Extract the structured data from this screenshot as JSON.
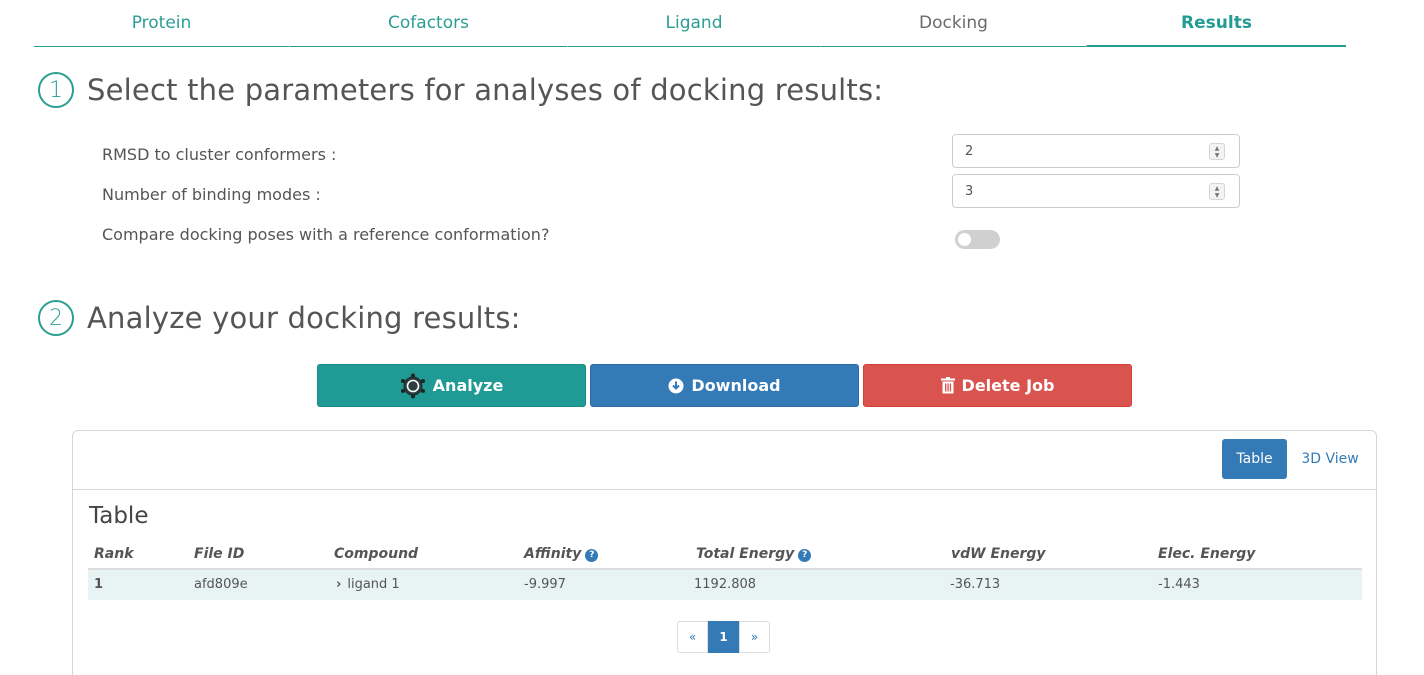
{
  "tabs": [
    {
      "label": "Protein"
    },
    {
      "label": "Cofactors"
    },
    {
      "label": "Ligand"
    },
    {
      "label": "Docking"
    },
    {
      "label": "Results"
    }
  ],
  "section1": {
    "number": "1",
    "title": "Select the parameters for analyses of docking results:",
    "rmsd_label": "RMSD to cluster conformers :",
    "rmsd_value": "2",
    "modes_label": "Number of binding modes :",
    "modes_value": "3",
    "compare_label": "Compare docking poses with a reference conformation?",
    "compare_enabled": false
  },
  "section2": {
    "number": "2",
    "title": "Analyze your docking results:"
  },
  "actions": {
    "analyze": "Analyze",
    "download": "Download",
    "delete": "Delete Job"
  },
  "panel": {
    "view_table": "Table",
    "view_3d": "3D View",
    "title": "Table"
  },
  "table": {
    "headers": [
      "Rank",
      "File ID",
      "Compound",
      "Affinity",
      "Total Energy",
      "vdW Energy",
      "Elec. Energy"
    ],
    "rows": [
      {
        "rank": "1",
        "file_id": "afd809e",
        "compound": "ligand 1",
        "affinity": "-9.997",
        "total_energy": "1192.808",
        "vdw_energy": "-36.713",
        "elec_energy": "-1.443"
      }
    ]
  },
  "pagination": {
    "prev": "«",
    "current": "1",
    "next": "»"
  },
  "colors": {
    "teal": "#209a94",
    "blue": "#337ab7",
    "red": "#d9534f"
  }
}
